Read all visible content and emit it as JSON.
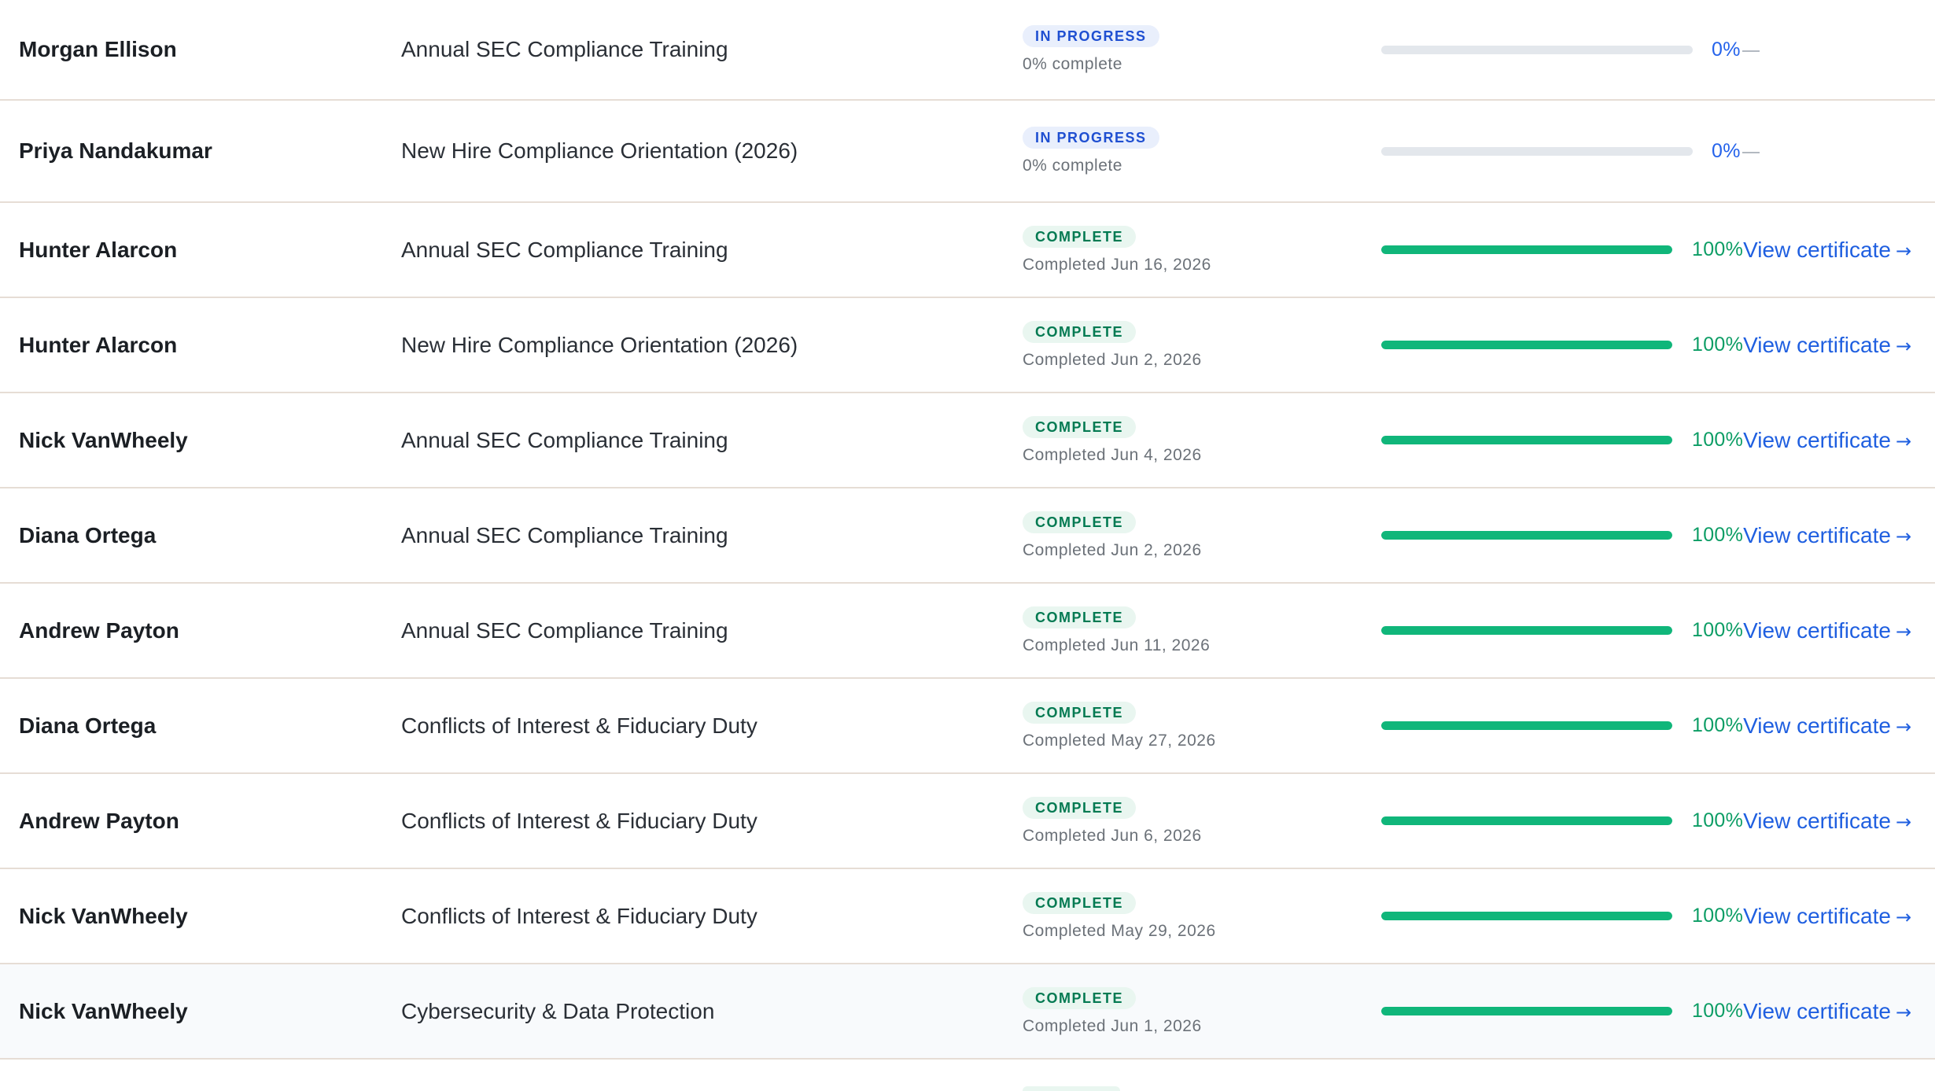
{
  "colors": {
    "complete_text": "#047a52",
    "complete_bg": "#e9f6f0",
    "in_progress_text": "#1f4fd1",
    "in_progress_bg": "#e9effc",
    "progress_fill": "#10b67a",
    "progress_track": "#e3e7ec",
    "link": "#1f5fe0",
    "row_divider": "#e6ddd5"
  },
  "rows": [
    {
      "name": "Morgan Ellison",
      "course": "Annual SEC Compliance Training",
      "status": "IN PROGRESS",
      "detail": "0% complete",
      "progress": 0,
      "percent_label": "0%",
      "empty_marker": "—"
    },
    {
      "name": "Priya Nandakumar",
      "course": "New Hire Compliance Orientation (2026)",
      "status": "IN PROGRESS",
      "detail": "0% complete",
      "progress": 0,
      "percent_label": "0%",
      "empty_marker": "—"
    },
    {
      "name": "Hunter Alarcon",
      "course": "Annual SEC Compliance Training",
      "status": "COMPLETE",
      "detail": "Completed Jun 16, 2026",
      "progress": 100,
      "percent_label": "100%",
      "link_label": "View certificate",
      "link_arrow": "→"
    },
    {
      "name": "Hunter Alarcon",
      "course": "New Hire Compliance Orientation (2026)",
      "status": "COMPLETE",
      "detail": "Completed Jun 2, 2026",
      "progress": 100,
      "percent_label": "100%",
      "link_label": "View certificate",
      "link_arrow": "→"
    },
    {
      "name": "Nick VanWheely",
      "course": "Annual SEC Compliance Training",
      "status": "COMPLETE",
      "detail": "Completed Jun 4, 2026",
      "progress": 100,
      "percent_label": "100%",
      "link_label": "View certificate",
      "link_arrow": "→"
    },
    {
      "name": "Diana Ortega",
      "course": "Annual SEC Compliance Training",
      "status": "COMPLETE",
      "detail": "Completed Jun 2, 2026",
      "progress": 100,
      "percent_label": "100%",
      "link_label": "View certificate",
      "link_arrow": "→"
    },
    {
      "name": "Andrew Payton",
      "course": "Annual SEC Compliance Training",
      "status": "COMPLETE",
      "detail": "Completed Jun 11, 2026",
      "progress": 100,
      "percent_label": "100%",
      "link_label": "View certificate",
      "link_arrow": "→"
    },
    {
      "name": "Diana Ortega",
      "course": "Conflicts of Interest & Fiduciary Duty",
      "status": "COMPLETE",
      "detail": "Completed May 27, 2026",
      "progress": 100,
      "percent_label": "100%",
      "link_label": "View certificate",
      "link_arrow": "→"
    },
    {
      "name": "Andrew Payton",
      "course": "Conflicts of Interest & Fiduciary Duty",
      "status": "COMPLETE",
      "detail": "Completed Jun 6, 2026",
      "progress": 100,
      "percent_label": "100%",
      "link_label": "View certificate",
      "link_arrow": "→"
    },
    {
      "name": "Nick VanWheely",
      "course": "Conflicts of Interest & Fiduciary Duty",
      "status": "COMPLETE",
      "detail": "Completed May 29, 2026",
      "progress": 100,
      "percent_label": "100%",
      "link_label": "View certificate",
      "link_arrow": "→"
    },
    {
      "name": "Nick VanWheely",
      "course": "Cybersecurity & Data Protection",
      "status": "COMPLETE",
      "detail": "Completed Jun 1, 2026",
      "progress": 100,
      "percent_label": "100%",
      "link_label": "View certificate",
      "link_arrow": "→"
    }
  ]
}
